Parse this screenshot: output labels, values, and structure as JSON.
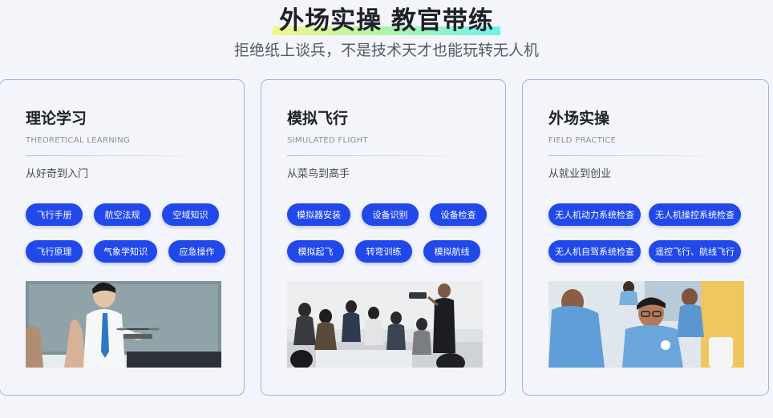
{
  "header": {
    "title": "外场实操 教官带练",
    "subtitle": "拒绝纸上谈兵，不是技术天才也能玩转无人机"
  },
  "cards": [
    {
      "title": "理论学习",
      "subtitle": "THEORETICAL LEARNING",
      "desc": "从好奇到入门",
      "tags": [
        "飞行手册",
        "航空法规",
        "空域知识",
        "飞行原理",
        "气象学知识",
        "应急操作"
      ]
    },
    {
      "title": "模拟飞行",
      "subtitle": "SIMULATED FLIGHT",
      "desc": "从菜鸟到高手",
      "tags": [
        "模拟器安装",
        "设备识别",
        "设备检查",
        "模拟起飞",
        "转弯训练",
        "模拟航线"
      ]
    },
    {
      "title": "外场实操",
      "subtitle": "FIELD PRACTICE",
      "desc": "从就业到创业",
      "tags": [
        "无人机动力系统检查",
        "无人机操控系统检查",
        "无人机自驾系统检查",
        "遥控飞行、航线飞行"
      ]
    }
  ],
  "colors": {
    "accent": "#2148e8",
    "card_border": "#9ab2ec",
    "background": "#f4f5fa"
  }
}
